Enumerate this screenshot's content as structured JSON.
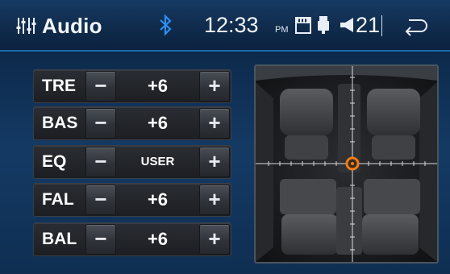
{
  "header": {
    "title": "Audio",
    "time": "12:33",
    "ampm": "PM",
    "volume": "21"
  },
  "controls": [
    {
      "label": "TRE",
      "value": "+6",
      "minus": "−",
      "plus": "+"
    },
    {
      "label": "BAS",
      "value": "+6",
      "minus": "−",
      "plus": "+"
    },
    {
      "label": "EQ",
      "value": "USER",
      "minus": "−",
      "plus": "+"
    },
    {
      "label": "FAL",
      "value": "+6",
      "minus": "−",
      "plus": "+"
    },
    {
      "label": "BAL",
      "value": "+6",
      "minus": "−",
      "plus": "+"
    }
  ],
  "colors": {
    "accent": "#1b6aa8",
    "bluetooth": "#2f8ff0",
    "marker": "#f07d14"
  },
  "icons": {
    "eq": "equalizer-icon",
    "bluetooth": "bluetooth-icon",
    "sd": "sd-card-icon",
    "usb": "usb-icon",
    "volume": "speaker-icon",
    "back": "back-arrow-icon"
  },
  "balance_fader": {
    "position": "center"
  }
}
